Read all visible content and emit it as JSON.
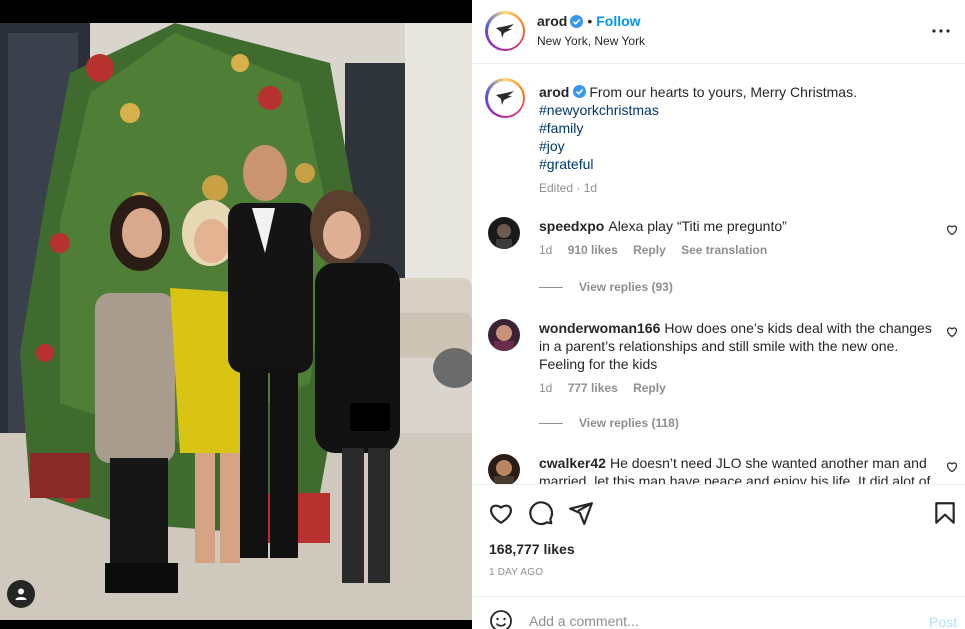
{
  "header": {
    "username": "arod",
    "follow_label": "Follow",
    "separator": "•",
    "location": "New York, New York"
  },
  "caption": {
    "username": "arod",
    "text": "From our hearts to yours, Merry Christmas.",
    "hashtags": [
      "#newyorkchristmas",
      "#family",
      "#joy",
      "#grateful"
    ],
    "edited": "Edited · 1d"
  },
  "comments": [
    {
      "username": "speedxpo",
      "text": "Alexa play “Titi me pregunto”",
      "time": "1d",
      "likes": "910 likes",
      "reply": "Reply",
      "translate": "See translation",
      "view_replies": "View replies (93)"
    },
    {
      "username": "wonderwoman166",
      "text": "How does one’s kids deal with the changes in a parent’s relationships and still smile with the new one. Feeling for the kids",
      "time": "1d",
      "likes": "777 likes",
      "reply": "Reply",
      "view_replies": "View replies (118)"
    },
    {
      "username": "cwalker42",
      "text": "He doesn’t need JLO she wanted another man and married. let this man have peace and enjoy his life. It did alot of"
    }
  ],
  "actions": {
    "likes": "168,777 likes",
    "date": "1 DAY AGO"
  },
  "comment_box": {
    "placeholder": "Add a comment...",
    "post_label": "Post"
  },
  "colors": {
    "accent": "#0095f6",
    "verified": "#3897f0",
    "hashtag": "#00376b",
    "muted": "#8e8e8e"
  },
  "icons": [
    "user-tag-icon",
    "verified-icon",
    "more-options-icon",
    "heart-icon",
    "comment-icon",
    "share-icon",
    "bookmark-icon",
    "emoji-icon"
  ]
}
